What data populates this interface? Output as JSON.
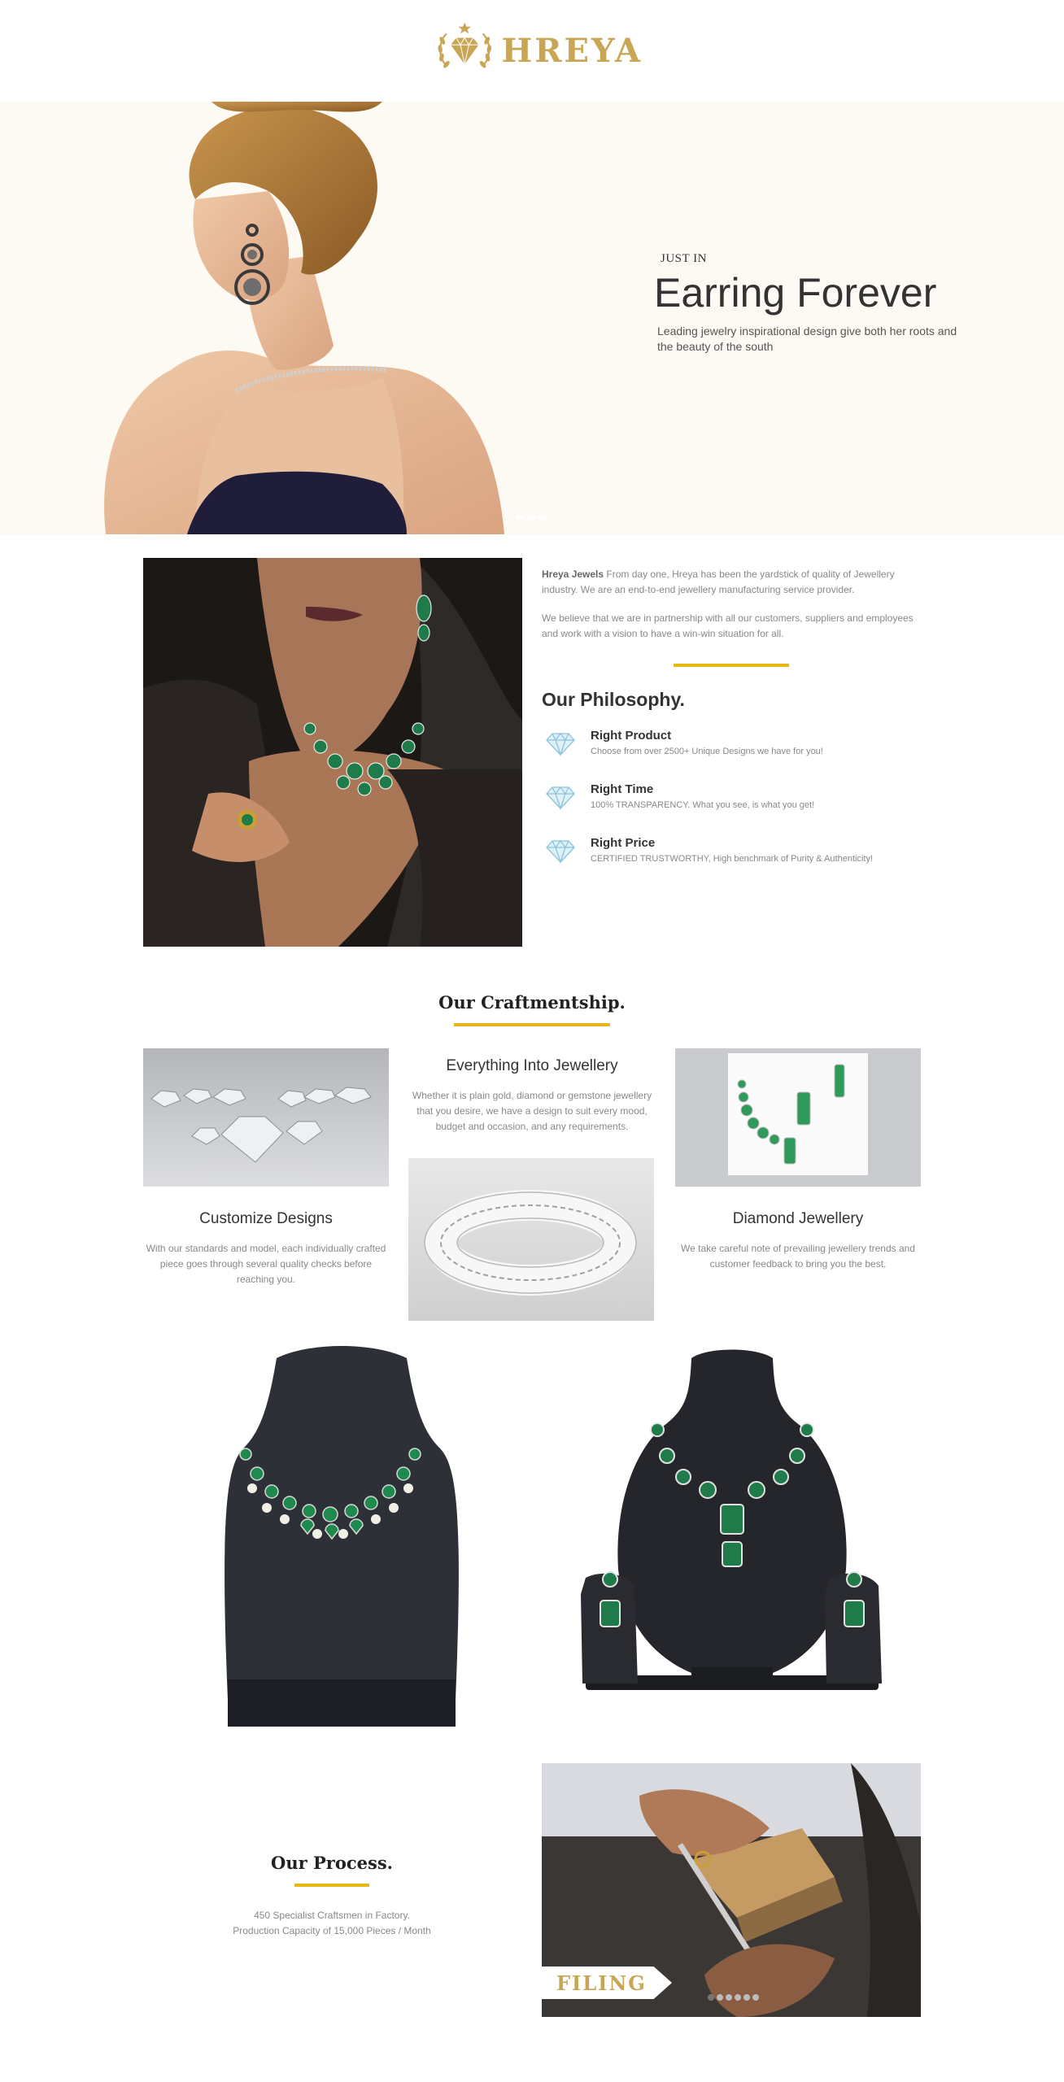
{
  "brand": {
    "name": "HREYA",
    "color": "#c8a653",
    "logo_icon": "diamond-crest-icon"
  },
  "hero": {
    "kicker": "JUST IN",
    "title": "Earring Forever",
    "text": "Leading jewelry inspirational design give both her roots and the beauty of the south",
    "slides": 3
  },
  "about": {
    "p1_bold": "Hreya Jewels",
    "p1": " From day one, Hreya has been the yardstick of quality of Jewellery industry. We are an end-to-end jewellery manufacturing service provider.",
    "p2": "We believe that we are in partnership with all our customers, suppliers and employees and work with a vision to have a win-win situation for all.",
    "accent": "#e6b817"
  },
  "philosophy": {
    "title": "Our Philosophy.",
    "items": [
      {
        "title": "Right Product",
        "text": "Choose from over 2500+ Unique Designs we have for you!",
        "icon": "diamond-icon"
      },
      {
        "title": "Right Time",
        "text": "100% TRANSPARENCY. What you see, is what you get!",
        "icon": "diamond-icon"
      },
      {
        "title": "Right Price",
        "text": "CERTIFIED TRUSTWORTHY, High benchmark of Purity & Authenticity!",
        "icon": "diamond-icon"
      }
    ]
  },
  "craft": {
    "title": "Our Craftmentship.",
    "middle": {
      "title": "Everything Into Jewellery",
      "text": "Whether it is plain gold, diamond or gemstone jewellery that you desire, we have a design to suit every mood, budget and occasion, and any requirements."
    },
    "left": {
      "title": "Customize Designs",
      "text": "With our standards and model, each individually crafted piece goes through several quality checks before reaching you."
    },
    "right": {
      "title": "Diamond Jewellery",
      "text": "We take careful note of prevailing jewellery trends and customer feedback to bring you the best."
    }
  },
  "process": {
    "title": "Our Process.",
    "line1": "450 Specialist Craftsmen in Factory.",
    "line2": "Production Capacity of 15,000 Pieces / Month",
    "slide_label": "FILING",
    "slides": 6
  }
}
